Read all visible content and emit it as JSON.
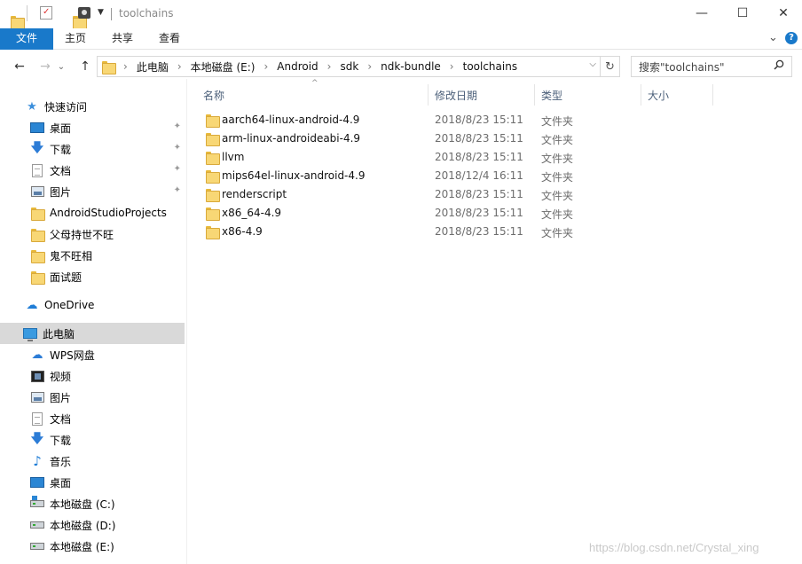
{
  "titlebar": {
    "title": "toolchains",
    "minimize": "—",
    "maximize": "☐",
    "close": "✕"
  },
  "ribbon": {
    "tabs": [
      "文件",
      "主页",
      "共享",
      "查看"
    ],
    "expand_glyph": "⌄",
    "help_glyph": "?"
  },
  "nav": {
    "back": "←",
    "forward": "→",
    "recent": "⌄",
    "up": "↑",
    "breadcrumbs": [
      "此电脑",
      "本地磁盘 (E:)",
      "Android",
      "sdk",
      "ndk-bundle",
      "toolchains"
    ],
    "separator": "›",
    "dropdown": "⌵",
    "refresh": "↻",
    "search_placeholder": "搜索\"toolchains\""
  },
  "sidebar": {
    "quick_access": "快速访问",
    "quick_items": [
      {
        "label": "桌面",
        "icon": "desktop-icon",
        "pinned": true
      },
      {
        "label": "下载",
        "icon": "download-icon",
        "pinned": true
      },
      {
        "label": "文档",
        "icon": "document-icon",
        "pinned": true
      },
      {
        "label": "图片",
        "icon": "picture-icon",
        "pinned": true
      },
      {
        "label": "AndroidStudioProjects",
        "icon": "folder-icon"
      },
      {
        "label": "父母持世不旺",
        "icon": "folder-icon"
      },
      {
        "label": "鬼不旺相",
        "icon": "folder-icon"
      },
      {
        "label": "面试题",
        "icon": "folder-icon"
      }
    ],
    "onedrive": "OneDrive",
    "this_pc": "此电脑",
    "pc_items": [
      {
        "label": "WPS网盘",
        "icon": "wps-cloud-icon"
      },
      {
        "label": "视频",
        "icon": "video-icon"
      },
      {
        "label": "图片",
        "icon": "picture-icon"
      },
      {
        "label": "文档",
        "icon": "document-icon"
      },
      {
        "label": "下载",
        "icon": "download-icon"
      },
      {
        "label": "音乐",
        "icon": "music-icon"
      },
      {
        "label": "桌面",
        "icon": "desktop-icon"
      },
      {
        "label": "本地磁盘 (C:)",
        "icon": "system-drive-icon"
      },
      {
        "label": "本地磁盘 (D:)",
        "icon": "drive-icon"
      },
      {
        "label": "本地磁盘 (E:)",
        "icon": "drive-icon"
      }
    ],
    "pin_glyph": "📌"
  },
  "columns": {
    "name": "名称",
    "date": "修改日期",
    "type": "类型",
    "size": "大小",
    "sort_glyph": "^"
  },
  "files": [
    {
      "name": "aarch64-linux-android-4.9",
      "date": "2018/8/23 15:11",
      "type": "文件夹"
    },
    {
      "name": "arm-linux-androideabi-4.9",
      "date": "2018/8/23 15:11",
      "type": "文件夹"
    },
    {
      "name": "llvm",
      "date": "2018/8/23 15:11",
      "type": "文件夹"
    },
    {
      "name": "mips64el-linux-android-4.9",
      "date": "2018/12/4 16:11",
      "type": "文件夹"
    },
    {
      "name": "renderscript",
      "date": "2018/8/23 15:11",
      "type": "文件夹"
    },
    {
      "name": "x86_64-4.9",
      "date": "2018/8/23 15:11",
      "type": "文件夹"
    },
    {
      "name": "x86-4.9",
      "date": "2018/8/23 15:11",
      "type": "文件夹"
    }
  ],
  "watermark": "https://blog.csdn.net/Crystal_xing",
  "colors": {
    "accent": "#1979ca",
    "selected_bg": "#d9d9d9",
    "folder": "#f8d775"
  }
}
